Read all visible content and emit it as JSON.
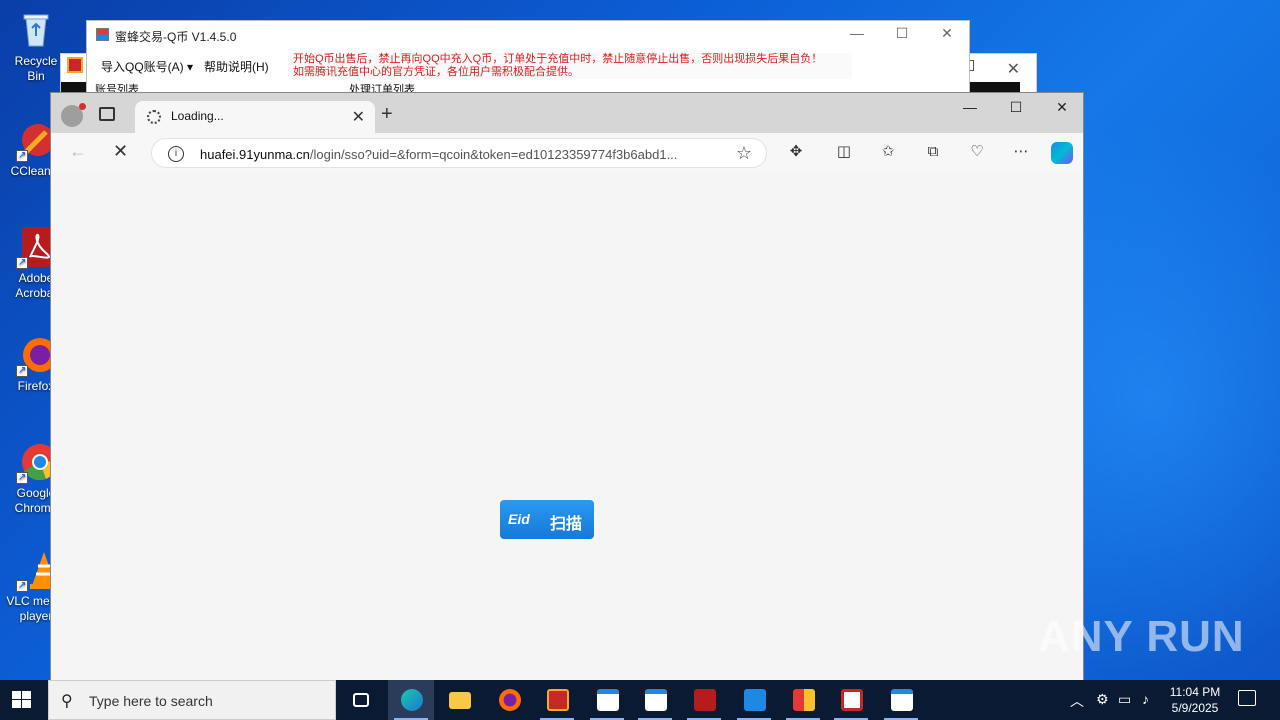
{
  "desktop": {
    "icons": [
      {
        "label": "Recycle Bin",
        "icon": "recycle-bin-icon"
      },
      {
        "label": "CCleaner",
        "icon": "ccleaner-icon"
      },
      {
        "label": "Adobe Acrobat",
        "icon": "acrobat-icon"
      },
      {
        "label": "Firefox",
        "icon": "firefox-icon"
      },
      {
        "label": "Google Chrome",
        "icon": "chrome-icon"
      },
      {
        "label": "VLC media player",
        "icon": "vlc-icon"
      }
    ]
  },
  "app_window": {
    "title": "蜜蜂交易-Q币 V1.4.5.0",
    "menu": [
      "导入QQ账号(A)",
      "帮助说明(H)"
    ],
    "notice_line1": "开始Q币出售后，禁止再向QQ中充入Q币，订单处于充值中时，禁止随意停止出售，否则出现损失后果自负！",
    "notice_line2": "如需腾讯充值中心的官方凭证，各位用户需积极配合提供。",
    "col_accounts": "账号列表",
    "col_orders": "处理订单列表"
  },
  "browser": {
    "tab_title": "Loading...",
    "url_host": "huafei.91yunma.cn",
    "url_path": "/login/sso?uid=&form=qcoin&token=ed10123359774f3b6abd1...",
    "scan_button": {
      "eid": "Eid",
      "label": "扫描"
    }
  },
  "watermark": "ANY RUN",
  "taskbar": {
    "search_placeholder": "Type here to search",
    "time": "11:04 PM",
    "date": "5/9/2025"
  },
  "colors": {
    "accent_blue": "#1678d8",
    "notice_red": "#e01b1b",
    "taskbar": "#0b1a33"
  }
}
